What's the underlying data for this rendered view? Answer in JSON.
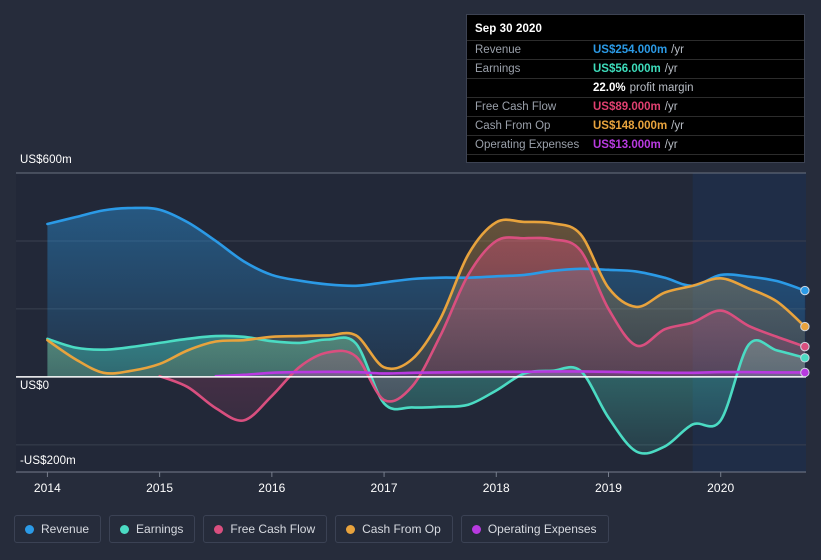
{
  "tooltip": {
    "date": "Sep 30 2020",
    "rows": [
      {
        "label": "Revenue",
        "value": "US$254.000m",
        "unit": "/yr",
        "color": "#2b9ae6"
      },
      {
        "label": "Earnings",
        "value": "US$56.000m",
        "unit": "/yr",
        "color": "#3ddcbb"
      },
      {
        "label": "",
        "value": "22.0%",
        "unit": "profit margin",
        "color": "#ffffff"
      },
      {
        "label": "Free Cash Flow",
        "value": "US$89.000m",
        "unit": "/yr",
        "color": "#e04070"
      },
      {
        "label": "Cash From Op",
        "value": "US$148.000m",
        "unit": "/yr",
        "color": "#e8a33d"
      },
      {
        "label": "Operating Expenses",
        "value": "US$13.000m",
        "unit": "/yr",
        "color": "#b83ae0"
      }
    ]
  },
  "legend": {
    "items": [
      {
        "label": "Revenue",
        "color": "#2b9ae6"
      },
      {
        "label": "Earnings",
        "color": "#4bdbc3"
      },
      {
        "label": "Free Cash Flow",
        "color": "#d94f7f"
      },
      {
        "label": "Cash From Op",
        "color": "#e8a33d"
      },
      {
        "label": "Operating Expenses",
        "color": "#b83ae0"
      }
    ]
  },
  "chart_data": {
    "type": "area",
    "title": "",
    "xlabel": "",
    "ylabel": "",
    "currency": "USD",
    "units": "millions",
    "grid": true,
    "legend_position": "bottom",
    "xlim": [
      2013.72,
      2020.76
    ],
    "ylim": [
      -280,
      600
    ],
    "yticks": [
      600,
      400,
      200,
      0,
      -200
    ],
    "ytick_labels": [
      "US$600m",
      "",
      "",
      "US$0",
      "-US$200m"
    ],
    "ytick_labels_visible": [
      "US$600m",
      "US$0",
      "-US$200m"
    ],
    "xticks": [
      2014,
      2015,
      2016,
      2017,
      2018,
      2019,
      2020
    ],
    "xtick_labels": [
      "2014",
      "2015",
      "2016",
      "2017",
      "2018",
      "2019",
      "2020"
    ],
    "forecast_start": 2019.75,
    "x": [
      2014.0,
      2014.25,
      2014.5,
      2014.75,
      2015.0,
      2015.25,
      2015.5,
      2015.75,
      2016.0,
      2016.25,
      2016.5,
      2016.75,
      2017.0,
      2017.25,
      2017.5,
      2017.75,
      2018.0,
      2018.25,
      2018.5,
      2018.75,
      2019.0,
      2019.25,
      2019.5,
      2019.75,
      2020.0,
      2020.25,
      2020.5,
      2020.75
    ],
    "series": [
      {
        "name": "Revenue",
        "color": "#2b9ae6",
        "values": [
          450,
          470,
          490,
          497,
          492,
          455,
          400,
          340,
          300,
          283,
          272,
          268,
          278,
          288,
          292,
          292,
          296,
          300,
          312,
          318,
          315,
          310,
          292,
          268,
          300,
          295,
          282,
          254
        ]
      },
      {
        "name": "Earnings",
        "color": "#4bdbc3",
        "values": [
          112,
          86,
          80,
          88,
          100,
          112,
          120,
          118,
          105,
          100,
          110,
          98,
          -78,
          -90,
          -88,
          -82,
          -40,
          10,
          18,
          18,
          -120,
          -220,
          -205,
          -140,
          -128,
          95,
          78,
          56
        ]
      },
      {
        "name": "Free Cash Flow",
        "color": "#d94f7f",
        "values": [
          null,
          null,
          null,
          null,
          2,
          -30,
          -92,
          -128,
          -56,
          30,
          72,
          60,
          -68,
          -28,
          120,
          300,
          400,
          408,
          405,
          372,
          200,
          92,
          140,
          160,
          195,
          150,
          118,
          89
        ]
      },
      {
        "name": "Cash From Op",
        "color": "#e8a33d",
        "values": [
          108,
          52,
          12,
          18,
          38,
          78,
          104,
          108,
          118,
          120,
          122,
          122,
          28,
          52,
          170,
          360,
          455,
          456,
          452,
          420,
          262,
          206,
          248,
          268,
          290,
          260,
          222,
          148
        ]
      },
      {
        "name": "Operating Expenses",
        "color": "#b83ae0",
        "values": [
          null,
          null,
          null,
          null,
          null,
          null,
          2,
          6,
          12,
          14,
          15,
          14,
          10,
          12,
          13,
          14,
          15,
          15,
          16,
          16,
          15,
          13,
          12,
          12,
          14,
          14,
          13,
          13
        ]
      }
    ]
  }
}
